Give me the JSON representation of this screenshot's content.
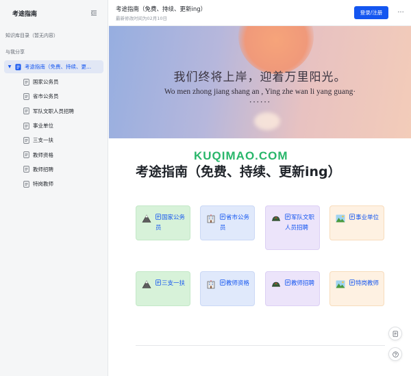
{
  "sidebar": {
    "title": "考途指南",
    "section_knowledge": "知识库目录（暂无内容）",
    "section_shared": "与我分享",
    "root_item": "考途指南（免费、持续、更...",
    "items": [
      {
        "label": "国家公务员"
      },
      {
        "label": "省市公务员"
      },
      {
        "label": "军队文职人员招聘"
      },
      {
        "label": "事业单位"
      },
      {
        "label": "三支一扶"
      },
      {
        "label": "教师资格"
      },
      {
        "label": "教师招聘"
      },
      {
        "label": "特岗教师"
      }
    ]
  },
  "header": {
    "title": "考途指南（免费、持续、更新ing）",
    "meta": "最新修改时间为02月10日",
    "login_label": "登录/注册",
    "more_label": "···"
  },
  "banner": {
    "cn_text": "我们终将上岸，迎着万里阳光。",
    "pinyin_text": "Wo men zhong jiang shang an , Ying zhe wan li yang guang·",
    "dots": "······"
  },
  "watermark": "KUQIMAO.COM",
  "main": {
    "title": "考途指南（免费、持续、更新ing）",
    "cards": [
      {
        "label": "国家公务员",
        "emoji": "mountain-icon"
      },
      {
        "label": "省市公务员",
        "emoji": "office-building-icon"
      },
      {
        "label": "军队文职人员招聘",
        "emoji": "military-helmet-icon"
      },
      {
        "label": "事业单位",
        "emoji": "landscape-icon"
      },
      {
        "label": "三支一扶",
        "emoji": "mountain-icon"
      },
      {
        "label": "教师资格",
        "emoji": "office-building-icon"
      },
      {
        "label": "教师招聘",
        "emoji": "military-helmet-icon"
      },
      {
        "label": "特岗教师",
        "emoji": "landscape-icon"
      }
    ]
  },
  "colors": {
    "accent": "#1456f0",
    "card_green": "#d7f2d9",
    "card_blue": "#e0e9fb",
    "card_purple": "#ece4fa",
    "card_orange": "#fef1e2"
  }
}
